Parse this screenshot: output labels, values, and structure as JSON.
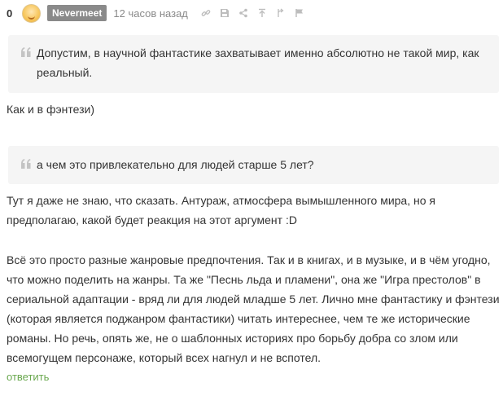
{
  "comment": {
    "rating": "0",
    "username": "Nevermeet",
    "timestamp": "12 часов назад",
    "tool_icons": [
      "link-icon",
      "save-icon",
      "share-icon",
      "up-icon",
      "branch-icon",
      "flag-icon"
    ],
    "quote1": "Допустим, в научной фантастике захватывает именно абсолютно не такой мир, как реальный.",
    "para1": "Как и в фэнтези)",
    "quote2": "а чем это привлекательно для людей старше 5 лет?",
    "para2": "Тут я даже не знаю, что сказать. Антураж, атмосфера вымышленного мира, но я предполагаю, какой будет реакция на этот аргумент :D",
    "para3": "Всё это просто разные жанровые предпочтения. Так и в книгах, и в музыке, и в чём угодно, что можно поделить на жанры. Та же \"Песнь льда и пламени\", она же \"Игра престолов\" в сериальной адаптации - вряд ли для людей младше 5 лет. Лично мне фантастику и фэнтези (которая является поджанром фантастики) читать интереснее, чем те же исторические романы. Но речь, опять же, не о шаблонных историях про борьбу добра со злом или всемогущем персонаже, который всех нагнул и не вспотел.",
    "reply_label": "ответить"
  },
  "colors": {
    "reply": "#6aa84f",
    "username_bg": "#8a8a8a",
    "quote_bg": "#f5f5f5"
  }
}
